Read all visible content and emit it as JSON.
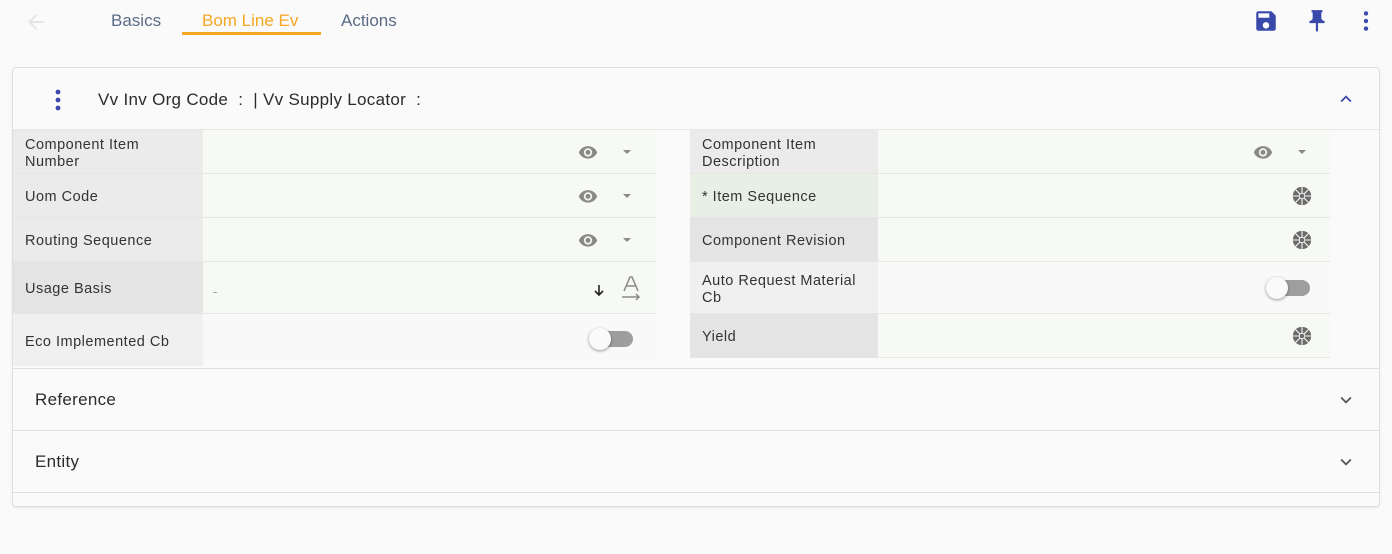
{
  "tabs": [
    {
      "label": "Basics"
    },
    {
      "label": "Bom Line Ev"
    },
    {
      "label": "Actions"
    }
  ],
  "active_tab": "Bom Line Ev",
  "header": {
    "title": "Vv Inv Org Code  :  | Vv Supply Locator  :"
  },
  "fields_left": [
    {
      "label": "Component Item Number",
      "value": ""
    },
    {
      "label": "Uom Code",
      "value": ""
    },
    {
      "label": "Routing Sequence",
      "value": ""
    },
    {
      "label": "Usage Basis",
      "value": "-"
    },
    {
      "label": "Eco Implemented Cb",
      "value": "off"
    }
  ],
  "fields_right": [
    {
      "label": "Component Item Description",
      "value": ""
    },
    {
      "label": "* Item Sequence",
      "value": ""
    },
    {
      "label": "Component Revision",
      "value": ""
    },
    {
      "label": "Auto Request Material Cb",
      "value": "off"
    },
    {
      "label": "Yield",
      "value": ""
    }
  ],
  "sections": [
    {
      "title": "Reference"
    },
    {
      "title": "Entity"
    }
  ],
  "colors": {
    "accent": "#f5a623",
    "primary_icon": "#3949ab",
    "label_bg": "#ebebeb",
    "value_bg": "#f7f9f4"
  },
  "icons": {
    "back": "arrow-left-icon",
    "save": "floppy-disk-icon",
    "pin": "pin-icon",
    "menu": "kebab-menu-icon"
  }
}
